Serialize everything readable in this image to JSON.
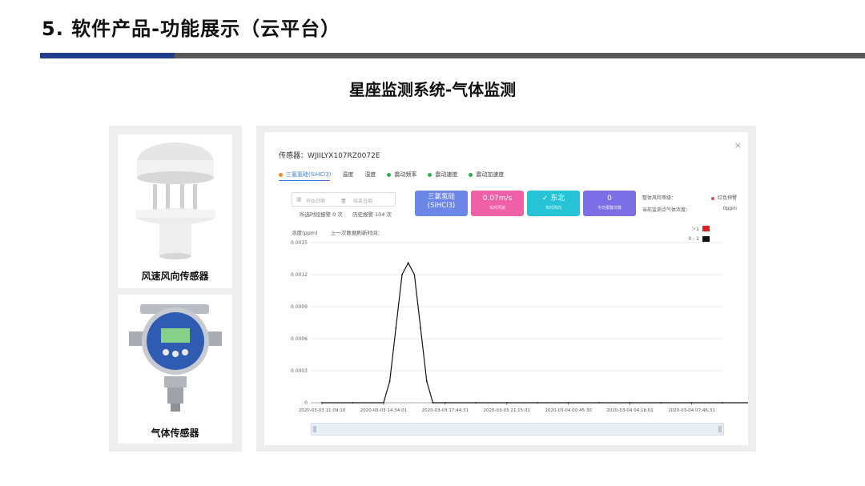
{
  "slide": {
    "title": "5. 软件产品-功能展示（云平台）",
    "section_title": "星座监测系统-气体监测"
  },
  "sensors": {
    "wind_label": "风速风向传感器",
    "gas_label": "气体传感器"
  },
  "app": {
    "close_symbol": "×",
    "sensor_id": "传感器：WJIILYX107RZ0072E",
    "tabs": [
      {
        "label": "三氯氢硅(SiHCl3)",
        "dot_color": "#f08a2c"
      },
      {
        "label": "温度",
        "dot_color": ""
      },
      {
        "label": "湿度",
        "dot_color": ""
      },
      {
        "label": "震动频率",
        "dot_color": "#2fb24a"
      },
      {
        "label": "震动速度",
        "dot_color": "#2fb24a"
      },
      {
        "label": "震动加速度",
        "dot_color": "#2fb24a"
      }
    ],
    "date_start_placeholder": "开始日期",
    "date_sep": "至",
    "date_end_placeholder": "结束日期",
    "current_alarms": "所选时段报警 0 次",
    "history_alarms": "历史报警 104 次",
    "kpis": [
      {
        "value": "三氯氢硅\n(SiHCl3)",
        "label": "",
        "color": "#6c86e8"
      },
      {
        "value": "0.07m/s",
        "label": "实时风速",
        "color": "#f060a6"
      },
      {
        "value": "✓ 东北",
        "label": "实时风向",
        "color": "#26c2d6"
      },
      {
        "value": "0",
        "label": "今日报警次数",
        "color": "#7c6fe6"
      }
    ],
    "risk_level_label": "整体风险等级：",
    "risk_level_value": "红色预警",
    "current_conc_label": "当前监测点气体浓度：",
    "current_conc_value": "0ppm",
    "chart_unit": "浓度(ppm)",
    "last_update_label": "上一次数据刷新时间：",
    "legend": [
      {
        "label": "＞1",
        "color": "#e02020"
      },
      {
        "label": "0 - 1",
        "color": "#111111"
      }
    ]
  },
  "chart_data": {
    "type": "line",
    "ylabel": "浓度(ppm)",
    "ylim": [
      0,
      0.0015
    ],
    "yticks": [
      "0",
      "0.0003",
      "0.0006",
      "0.0009",
      "0.0012",
      "0.0015"
    ],
    "xtick_labels": [
      "2020-03-03 11:09:10",
      "2020-03-03 14:34:01",
      "2020-03-03 17:44:31",
      "2020-03-03 21:15:01",
      "2020-03-04 00:45:30",
      "2020-03-04 04:16:01",
      "2020-03-04 07:46:31"
    ],
    "grid": true,
    "series": [
      {
        "color": "#111111",
        "x": [
          0,
          0.5,
          1.0,
          1.1,
          1.2,
          1.3,
          1.4,
          1.5,
          1.6,
          1.7,
          1.8,
          2.0,
          2.5,
          3.0,
          3.5,
          4.0,
          4.5,
          5.0,
          5.5,
          6.0,
          6.5,
          7.0
        ],
        "y": [
          0,
          0,
          0,
          0.0002,
          0.0007,
          0.0012,
          0.00131,
          0.0012,
          0.0007,
          0.0002,
          0,
          0,
          0,
          0,
          0,
          0,
          0,
          0,
          0,
          0,
          0,
          0
        ]
      }
    ]
  }
}
